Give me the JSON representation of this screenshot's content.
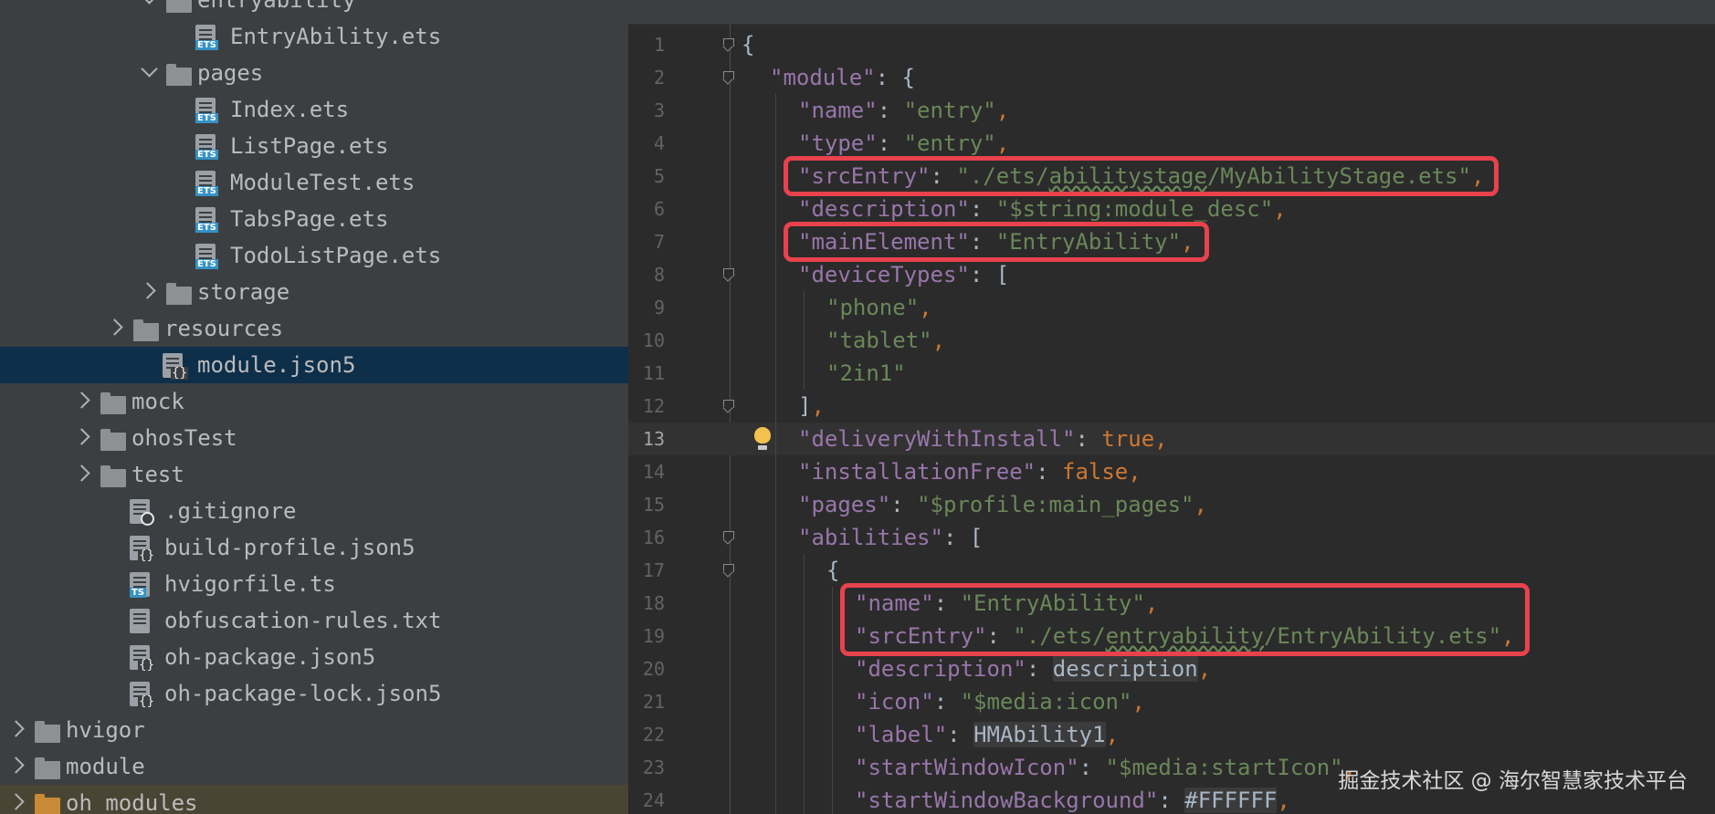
{
  "project_tree": {
    "rows": [
      {
        "label": "entryability",
        "type": "folder",
        "expanded": true,
        "depth": 5,
        "icon": "folder-icon"
      },
      {
        "label": "EntryAbility.ets",
        "type": "file",
        "depth": 6,
        "icon": "ets-file-icon",
        "tag": "ETS"
      },
      {
        "label": "pages",
        "type": "folder",
        "expanded": true,
        "depth": 5,
        "icon": "folder-icon"
      },
      {
        "label": "Index.ets",
        "type": "file",
        "depth": 6,
        "icon": "ets-file-icon",
        "tag": "ETS"
      },
      {
        "label": "ListPage.ets",
        "type": "file",
        "depth": 6,
        "icon": "ets-file-icon",
        "tag": "ETS"
      },
      {
        "label": "ModuleTest.ets",
        "type": "file",
        "depth": 6,
        "icon": "ets-file-icon",
        "tag": "ETS"
      },
      {
        "label": "TabsPage.ets",
        "type": "file",
        "depth": 6,
        "icon": "ets-file-icon",
        "tag": "ETS"
      },
      {
        "label": "TodoListPage.ets",
        "type": "file",
        "depth": 6,
        "icon": "ets-file-icon",
        "tag": "ETS"
      },
      {
        "label": "storage",
        "type": "folder",
        "expanded": false,
        "depth": 5,
        "icon": "folder-icon"
      },
      {
        "label": "resources",
        "type": "folder",
        "expanded": false,
        "depth": 4,
        "icon": "folder-icon"
      },
      {
        "label": "module.json5",
        "type": "file",
        "depth": 5,
        "icon": "json5-file-icon",
        "selected": true
      },
      {
        "label": "mock",
        "type": "folder",
        "expanded": false,
        "depth": 3,
        "icon": "folder-icon"
      },
      {
        "label": "ohosTest",
        "type": "folder",
        "expanded": false,
        "depth": 3,
        "icon": "folder-icon"
      },
      {
        "label": "test",
        "type": "folder",
        "expanded": false,
        "depth": 3,
        "icon": "folder-icon"
      },
      {
        "label": ".gitignore",
        "type": "file",
        "depth": 4,
        "icon": "gitignore-file-icon"
      },
      {
        "label": "build-profile.json5",
        "type": "file",
        "depth": 4,
        "icon": "json5-file-icon"
      },
      {
        "label": "hvigorfile.ts",
        "type": "file",
        "depth": 4,
        "icon": "ts-file-icon",
        "tag": "TS"
      },
      {
        "label": "obfuscation-rules.txt",
        "type": "file",
        "depth": 4,
        "icon": "text-file-icon"
      },
      {
        "label": "oh-package.json5",
        "type": "file",
        "depth": 4,
        "icon": "json5-file-icon"
      },
      {
        "label": "oh-package-lock.json5",
        "type": "file",
        "depth": 4,
        "icon": "json5-file-icon"
      },
      {
        "label": "hvigor",
        "type": "folder",
        "expanded": false,
        "depth": 1,
        "icon": "folder-icon"
      },
      {
        "label": "module",
        "type": "folder",
        "expanded": false,
        "depth": 1,
        "icon": "folder-icon"
      },
      {
        "label": "oh_modules",
        "type": "folder",
        "expanded": false,
        "depth": 1,
        "icon": "folder-icon",
        "special": "orange"
      }
    ]
  },
  "editor": {
    "current_line": 13,
    "lines": [
      {
        "n": "1",
        "indent": 0,
        "fold": true,
        "tokens": [
          {
            "t": "{",
            "c": "p"
          }
        ]
      },
      {
        "n": "2",
        "indent": 1,
        "fold": true,
        "tokens": [
          {
            "t": "\"module\"",
            "c": "k"
          },
          {
            "t": ": {",
            "c": "p"
          }
        ]
      },
      {
        "n": "3",
        "indent": 2,
        "tokens": [
          {
            "t": "\"name\"",
            "c": "k"
          },
          {
            "t": ": ",
            "c": "p"
          },
          {
            "t": "\"entry\"",
            "c": "s"
          },
          {
            "t": ",",
            "c": "b"
          }
        ]
      },
      {
        "n": "4",
        "indent": 2,
        "tokens": [
          {
            "t": "\"type\"",
            "c": "k"
          },
          {
            "t": ": ",
            "c": "p"
          },
          {
            "t": "\"entry\"",
            "c": "s"
          },
          {
            "t": ",",
            "c": "b"
          }
        ]
      },
      {
        "n": "5",
        "indent": 2,
        "tokens": [
          {
            "t": "\"srcEntry\"",
            "c": "k"
          },
          {
            "t": ": ",
            "c": "p"
          },
          {
            "t": "\"./ets/",
            "c": "s"
          },
          {
            "t": "abilitystage",
            "c": "s u"
          },
          {
            "t": "/MyAbilityStage.ets\"",
            "c": "s"
          },
          {
            "t": ",",
            "c": "b"
          }
        ]
      },
      {
        "n": "6",
        "indent": 2,
        "tokens": [
          {
            "t": "\"description\"",
            "c": "k"
          },
          {
            "t": ": ",
            "c": "p"
          },
          {
            "t": "\"$string:module_desc\"",
            "c": "s"
          },
          {
            "t": ",",
            "c": "b"
          }
        ]
      },
      {
        "n": "7",
        "indent": 2,
        "tokens": [
          {
            "t": "\"mainElement\"",
            "c": "k"
          },
          {
            "t": ": ",
            "c": "p"
          },
          {
            "t": "\"EntryAbility\"",
            "c": "s"
          },
          {
            "t": ",",
            "c": "b"
          }
        ]
      },
      {
        "n": "8",
        "indent": 2,
        "fold": true,
        "tokens": [
          {
            "t": "\"deviceTypes\"",
            "c": "k"
          },
          {
            "t": ": [",
            "c": "p"
          }
        ]
      },
      {
        "n": "9",
        "indent": 3,
        "tokens": [
          {
            "t": "\"phone\"",
            "c": "s"
          },
          {
            "t": ",",
            "c": "b"
          }
        ]
      },
      {
        "n": "10",
        "indent": 3,
        "tokens": [
          {
            "t": "\"tablet\"",
            "c": "s"
          },
          {
            "t": ",",
            "c": "b"
          }
        ]
      },
      {
        "n": "11",
        "indent": 3,
        "tokens": [
          {
            "t": "\"2in1\"",
            "c": "s"
          }
        ]
      },
      {
        "n": "12",
        "indent": 2,
        "fold": true,
        "tokens": [
          {
            "t": "]",
            "c": "p"
          },
          {
            "t": ",",
            "c": "b"
          }
        ]
      },
      {
        "n": "13",
        "indent": 2,
        "bulb": true,
        "tokens": [
          {
            "t": "\"deliveryWithInstall\"",
            "c": "k"
          },
          {
            "t": ": ",
            "c": "p"
          },
          {
            "t": "true",
            "c": "b"
          },
          {
            "t": ",",
            "c": "b"
          }
        ]
      },
      {
        "n": "14",
        "indent": 2,
        "tokens": [
          {
            "t": "\"installationFree\"",
            "c": "k"
          },
          {
            "t": ": ",
            "c": "p"
          },
          {
            "t": "false",
            "c": "b"
          },
          {
            "t": ",",
            "c": "b"
          }
        ]
      },
      {
        "n": "15",
        "indent": 2,
        "tokens": [
          {
            "t": "\"pages\"",
            "c": "k"
          },
          {
            "t": ": ",
            "c": "p"
          },
          {
            "t": "\"$profile:main_pages\"",
            "c": "s"
          },
          {
            "t": ",",
            "c": "b"
          }
        ]
      },
      {
        "n": "16",
        "indent": 2,
        "fold": true,
        "tokens": [
          {
            "t": "\"abilities\"",
            "c": "k"
          },
          {
            "t": ": [",
            "c": "p"
          }
        ]
      },
      {
        "n": "17",
        "indent": 3,
        "fold": true,
        "tokens": [
          {
            "t": "{",
            "c": "p"
          }
        ]
      },
      {
        "n": "18",
        "indent": 4,
        "tokens": [
          {
            "t": "\"name\"",
            "c": "k"
          },
          {
            "t": ": ",
            "c": "p"
          },
          {
            "t": "\"EntryAbility\"",
            "c": "s"
          },
          {
            "t": ",",
            "c": "b"
          }
        ]
      },
      {
        "n": "19",
        "indent": 4,
        "tokens": [
          {
            "t": "\"srcEntry\"",
            "c": "k"
          },
          {
            "t": ": ",
            "c": "p"
          },
          {
            "t": "\"./ets/",
            "c": "s"
          },
          {
            "t": "entryability",
            "c": "s u"
          },
          {
            "t": "/EntryAbility.ets\"",
            "c": "s"
          },
          {
            "t": ",",
            "c": "b"
          }
        ]
      },
      {
        "n": "20",
        "indent": 4,
        "tokens": [
          {
            "t": "\"description\"",
            "c": "k"
          },
          {
            "t": ": ",
            "c": "p"
          },
          {
            "t": "description",
            "c": "v"
          },
          {
            "t": ",",
            "c": "b"
          }
        ]
      },
      {
        "n": "21",
        "indent": 4,
        "tokens": [
          {
            "t": "\"icon\"",
            "c": "k"
          },
          {
            "t": ": ",
            "c": "p"
          },
          {
            "t": "\"$media:icon\"",
            "c": "s"
          },
          {
            "t": ",",
            "c": "b"
          }
        ]
      },
      {
        "n": "22",
        "indent": 4,
        "tokens": [
          {
            "t": "\"label\"",
            "c": "k"
          },
          {
            "t": ": ",
            "c": "p"
          },
          {
            "t": "HMAbility1",
            "c": "v"
          },
          {
            "t": ",",
            "c": "b"
          }
        ]
      },
      {
        "n": "23",
        "indent": 4,
        "tokens": [
          {
            "t": "\"startWindowIcon\"",
            "c": "k"
          },
          {
            "t": ": ",
            "c": "p"
          },
          {
            "t": "\"$media:startIcon\"",
            "c": "s"
          },
          {
            "t": ",",
            "c": "b"
          }
        ]
      },
      {
        "n": "24",
        "indent": 4,
        "tokens": [
          {
            "t": "\"startWindowBackground\"",
            "c": "k"
          },
          {
            "t": ": ",
            "c": "p"
          },
          {
            "t": "#FFFFFF",
            "c": "v"
          },
          {
            "t": ",",
            "c": "b"
          }
        ]
      }
    ]
  },
  "annotations": [
    {
      "name": "srcEntry-highlight",
      "lines": [
        5
      ]
    },
    {
      "name": "mainElement-highlight",
      "lines": [
        7
      ]
    },
    {
      "name": "ability-entry-highlight",
      "lines": [
        18,
        19
      ]
    }
  ],
  "watermark": "掘金技术社区 @ 海尔智慧家技术平台",
  "colors": {
    "sidebar_bg": "#3c3f41",
    "editor_bg": "#2b2b2b",
    "selected_row": "#0d2f4a",
    "json_key": "#9876aa",
    "json_string": "#6a8759",
    "keyword": "#cc7832",
    "annotation_red": "#e8424c"
  }
}
